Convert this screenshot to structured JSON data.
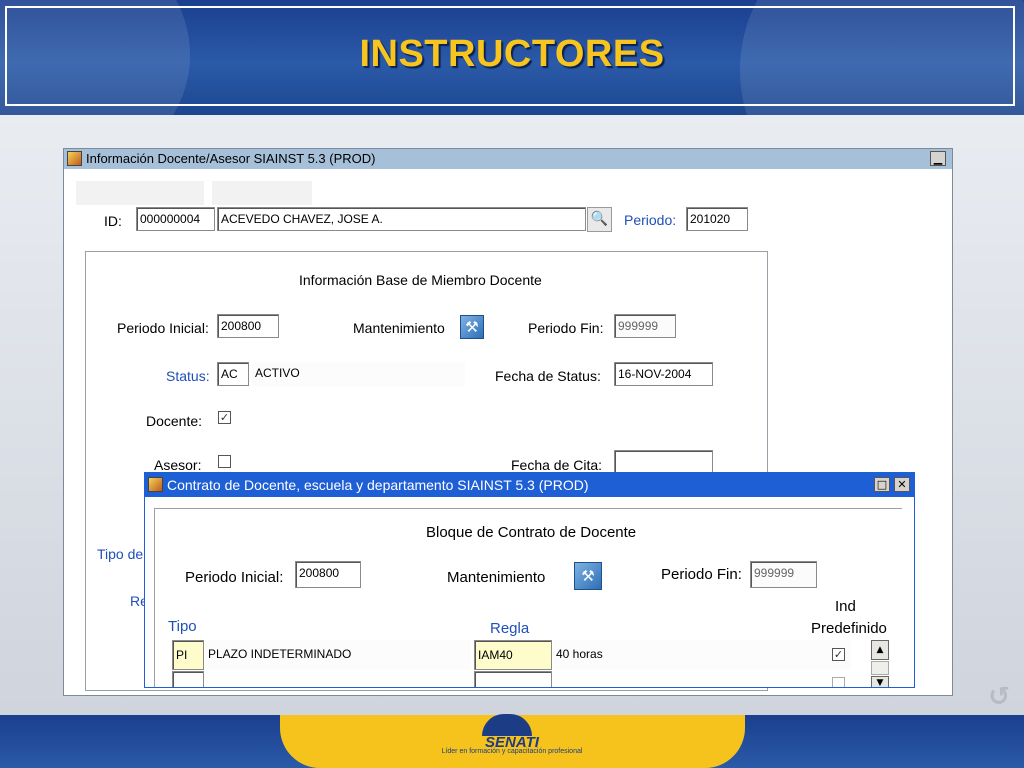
{
  "slide": {
    "title": "INSTRUCTORES"
  },
  "window_docente": {
    "title": "Información Docente/Asesor  SIAINST  5.3  (PROD)",
    "minimize_glyph": "▁",
    "id_label": "ID:",
    "id_value": "000000004",
    "name_value": "ACEVEDO CHAVEZ, JOSE A.",
    "periodo_label": "Periodo:",
    "periodo_value": "201020",
    "panel": {
      "heading": "Información Base de Miembro Docente",
      "periodo_inicial_label": "Periodo Inicial:",
      "periodo_inicial_value": "200800",
      "mantenimiento_label": "Mantenimiento",
      "periodo_fin_label": "Periodo Fin:",
      "periodo_fin_value": "999999",
      "status_label": "Status:",
      "status_code": "AC",
      "status_desc": "ACTIVO",
      "fecha_status_label": "Fecha de Status:",
      "fecha_status_value": "16-NOV-2004",
      "docente_label": "Docente:",
      "docente_checked": true,
      "asesor_label": "Asesor:",
      "asesor_checked": false,
      "fecha_cita_label": "Fecha de Cita:",
      "fecha_cita_value": "",
      "tipo_partial_label": "Tipo de",
      "re_partial_label": "Re"
    }
  },
  "window_contrato": {
    "title": "Contrato de Docente, escuela y departamento  SIAINST  5.3  (PROD)",
    "maximize_glyph": "□",
    "close_glyph": "✕",
    "heading": "Bloque de Contrato de Docente",
    "periodo_inicial_label": "Periodo Inicial:",
    "periodo_inicial_value": "200800",
    "mantenimiento_label": "Mantenimiento",
    "periodo_fin_label": "Periodo Fin:",
    "periodo_fin_value": "999999",
    "col_tipo": "Tipo",
    "col_regla": "Regla",
    "col_ind_line1": "Ind",
    "col_ind_line2": "Predefinido",
    "rows": [
      {
        "tipo": "PI",
        "tipo_desc": "PLAZO INDETERMINADO",
        "regla": "IAM40",
        "regla_desc": "40 horas",
        "ind": true
      },
      {
        "tipo": "",
        "tipo_desc": "",
        "regla": "",
        "regla_desc": "",
        "ind": false
      }
    ]
  },
  "footer": {
    "logo_text": "SENATI",
    "slogan": "Líder en formación y capacitación profesional"
  },
  "icons": {
    "search": "search-icon",
    "tool": "tool-icon",
    "return": "return-icon"
  },
  "colors": {
    "header_blue": "#1b3f8f",
    "title_yellow": "#f7c51e",
    "active_titlebar": "#1f5fd6",
    "inactive_titlebar": "#a7c0da",
    "label_blue": "#1f4fb8",
    "row_highlight": "#fffccc"
  }
}
